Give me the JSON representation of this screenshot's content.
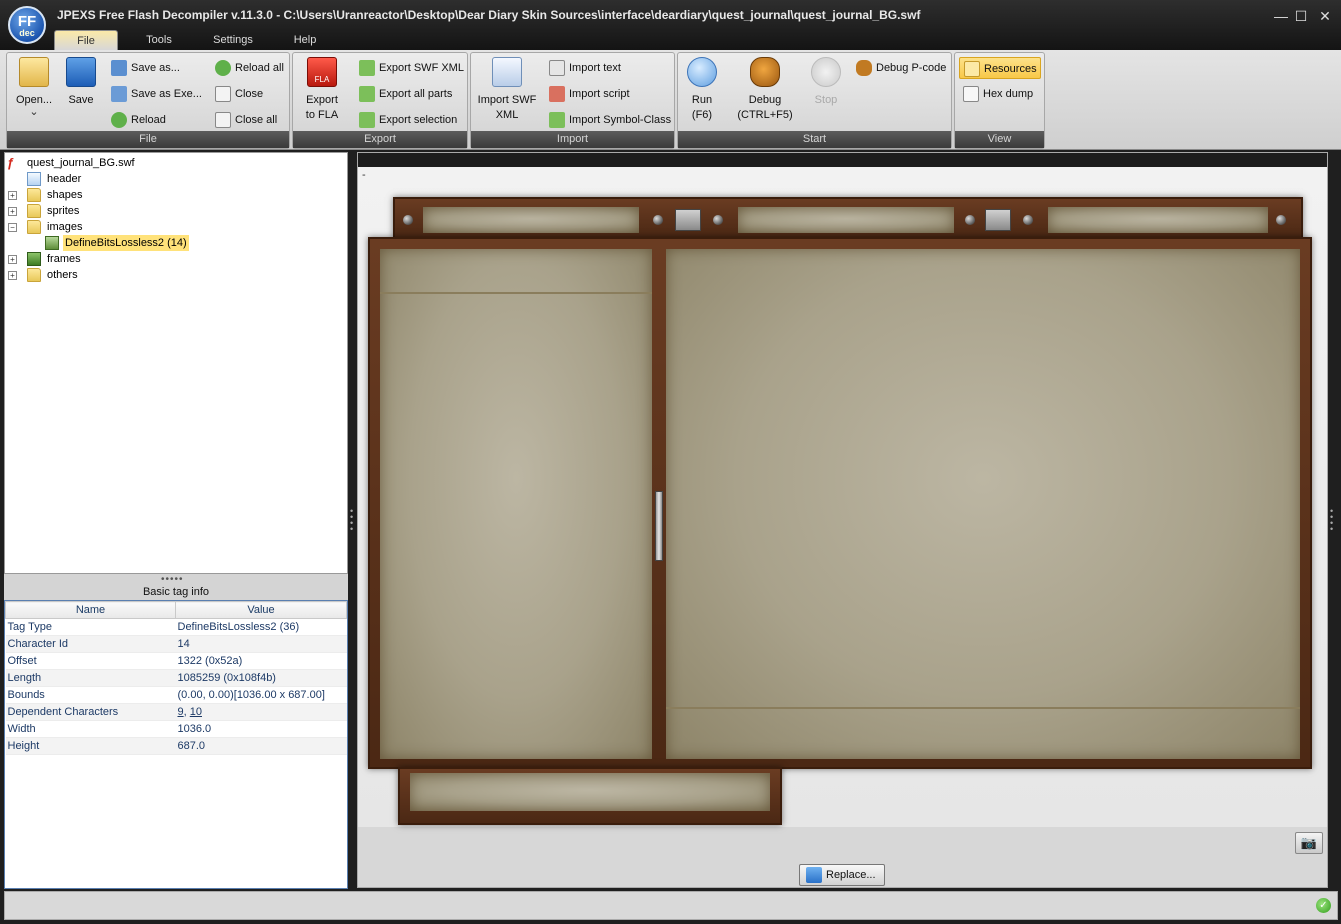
{
  "window": {
    "title": "JPEXS Free Flash Decompiler v.11.3.0 - C:\\Users\\Uranreactor\\Desktop\\Dear Diary Skin Sources\\interface\\deardiary\\quest_journal\\quest_journal_BG.swf",
    "logo_text": "FF",
    "logo_sub": "dec",
    "minimize": "—",
    "maximize": "☐",
    "close": "✕"
  },
  "menu_tabs": [
    "File",
    "Tools",
    "Settings",
    "Help"
  ],
  "ribbon": {
    "file_group": {
      "label": "File",
      "open": "Open...",
      "open_arrow": "⌄",
      "save": "Save",
      "save_as": "Save as...",
      "save_as_exe": "Save as Exe...",
      "reload": "Reload",
      "reload_all": "Reload all",
      "close": "Close",
      "close_all": "Close all"
    },
    "export_group": {
      "label": "Export",
      "export_fla_line1": "Export",
      "export_fla_line2": "to FLA",
      "fla_badge": "FLA",
      "export_swf_xml": "Export SWF XML",
      "export_all_parts": "Export all parts",
      "export_selection": "Export selection"
    },
    "import_group": {
      "label": "Import",
      "import_swf_xml_line1": "Import SWF",
      "import_swf_xml_line2": "XML",
      "import_text": "Import text",
      "import_script": "Import script",
      "import_symbol_class": "Import Symbol-Class"
    },
    "start_group": {
      "label": "Start",
      "run_line1": "Run",
      "run_line2": "(F6)",
      "debug_line1": "Debug",
      "debug_line2": "(CTRL+F5)",
      "stop": "Stop",
      "debug_pcode": "Debug P-code"
    },
    "view_group": {
      "label": "View",
      "resources": "Resources",
      "hex_dump": "Hex dump"
    }
  },
  "tree": {
    "root": "quest_journal_BG.swf",
    "header": "header",
    "shapes": "shapes",
    "sprites": "sprites",
    "images": "images",
    "image_item": "DefineBitsLossless2 (14)",
    "frames": "frames",
    "others": "others",
    "expand_glyph": "+",
    "collapse_glyph": "−"
  },
  "info_panel": {
    "splitter_dots": "•••••",
    "title": "Basic tag info",
    "columns": [
      "Name",
      "Value"
    ],
    "rows": [
      {
        "name": "Tag Type",
        "value": "DefineBitsLossless2 (36)"
      },
      {
        "name": "Character Id",
        "value": "14"
      },
      {
        "name": "Offset",
        "value": "1322 (0x52a)"
      },
      {
        "name": "Length",
        "value": "1085259 (0x108f4b)"
      },
      {
        "name": "Bounds",
        "value": "(0.00, 0.00)[1036.00 x 687.00]"
      },
      {
        "name": "Dependent Characters",
        "value_links": [
          "9",
          "10"
        ],
        "separator": ", "
      },
      {
        "name": "Width",
        "value": "1036.0"
      },
      {
        "name": "Height",
        "value": "687.0"
      }
    ]
  },
  "preview": {
    "dash": "-",
    "camera_icon": "📷",
    "replace_button": "Replace..."
  },
  "status": {
    "ok_icon": "✓"
  },
  "colors": {
    "selection": "#ffe27a",
    "ribbon_footer": "#3a3a3a",
    "resources_active": "#fbd562"
  }
}
